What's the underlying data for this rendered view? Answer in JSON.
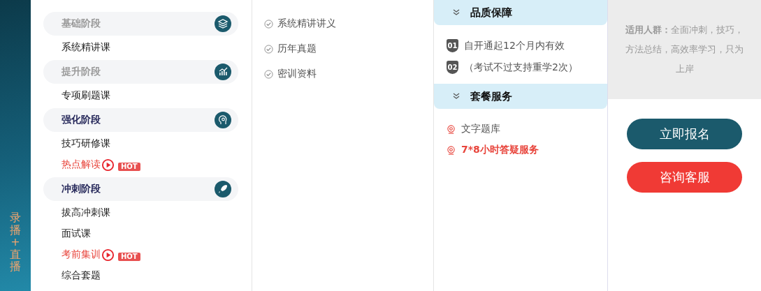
{
  "side_label": "录播+直播",
  "stages": [
    {
      "title": "基础阶段",
      "active": false,
      "items": [
        {
          "label": "系统精讲课",
          "hot": false
        }
      ]
    },
    {
      "title": "提升阶段",
      "active": false,
      "items": [
        {
          "label": "专项刷题课",
          "hot": false
        }
      ]
    },
    {
      "title": "强化阶段",
      "active": true,
      "items": [
        {
          "label": "技巧研修课",
          "hot": false
        },
        {
          "label": "热点解读",
          "hot": true,
          "badge": "HOT"
        }
      ]
    },
    {
      "title": "冲刺阶段",
      "active": true,
      "items": [
        {
          "label": "拔高冲刺课",
          "hot": false
        },
        {
          "label": "面试课",
          "hot": false
        },
        {
          "label": "考前集训",
          "hot": true,
          "badge": "HOT"
        },
        {
          "label": "综合套题",
          "hot": false
        }
      ]
    }
  ],
  "materials": [
    "系统精讲讲义",
    "历年真题",
    "密训资料"
  ],
  "quality": {
    "title": "品质保障",
    "items": [
      {
        "badge": "01",
        "text": "自开通起12个月内有效"
      },
      {
        "badge": "02",
        "text": "（考试不过支持重学2次）"
      }
    ]
  },
  "services": {
    "title": "套餐服务",
    "items": [
      {
        "text": "文字题库",
        "highlighted": false
      },
      {
        "text": "7*8小时答疑服务",
        "highlighted": true
      }
    ]
  },
  "audience": {
    "label": "适用人群：",
    "text": "全面冲刺，技巧，方法总结，高效率学习，只为上岸"
  },
  "buttons": [
    {
      "label": "立即报名",
      "kind": "primary"
    },
    {
      "label": "咨询客服",
      "kind": "danger"
    }
  ]
}
